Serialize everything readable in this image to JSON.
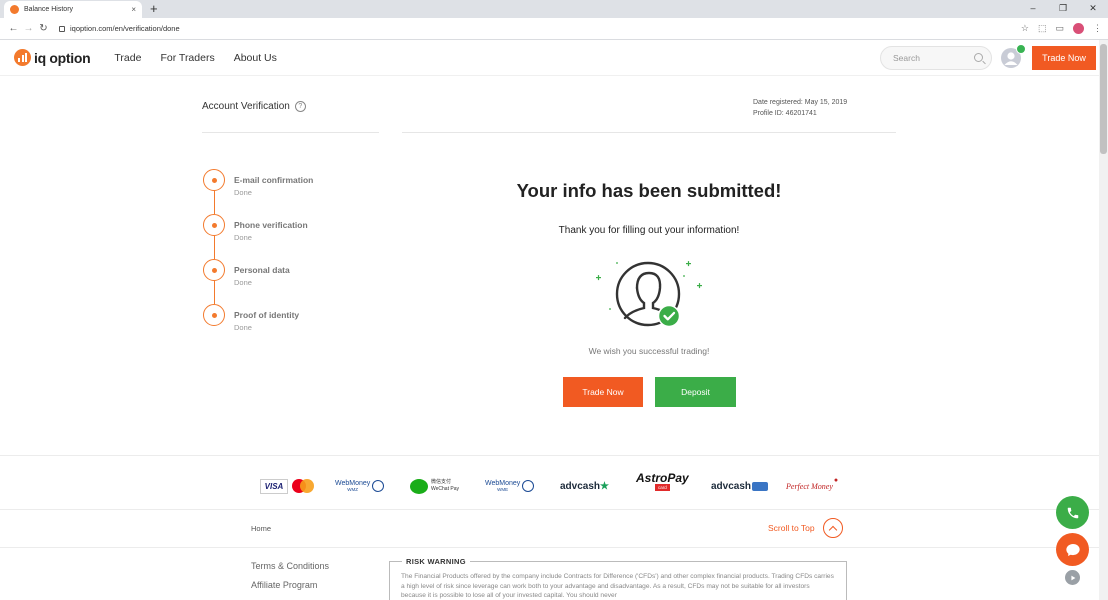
{
  "browser": {
    "tab_title": "Balance History",
    "tab_close": "×",
    "new_tab": "+",
    "url": "iqoption.com/en/verification/done",
    "window_controls": [
      "–",
      "❐",
      "✕"
    ]
  },
  "header": {
    "logo_text": "iq option",
    "nav": [
      "Trade",
      "For Traders",
      "About Us"
    ],
    "search_placeholder": "Search",
    "trade_now": "Trade Now"
  },
  "verification": {
    "title": "Account Verification",
    "help": "?",
    "date_registered": "Date registered: May 15, 2019",
    "profile_id": "Profile ID: 46201741",
    "steps": [
      {
        "title": "E-mail confirmation",
        "status": "Done"
      },
      {
        "title": "Phone verification",
        "status": "Done"
      },
      {
        "title": "Personal data",
        "status": "Done"
      },
      {
        "title": "Proof of identity",
        "status": "Done"
      }
    ],
    "headline": "Your info has been submitted!",
    "thanks": "Thank you for filling out your information!",
    "wish": "We wish you successful trading!",
    "trade_now": "Trade Now",
    "deposit": "Deposit"
  },
  "payments": {
    "visa": "VISA",
    "webmoney": "WebMoney",
    "wmz": "WMZ",
    "wme": "WME",
    "wechat_cn": "微信支付",
    "wechat_en": "WeChat Pay",
    "advcash": "advcash",
    "astropay": "AstroPay",
    "astropay_card": "card",
    "perfect_money": "Perfect Money"
  },
  "footer": {
    "home": "Home",
    "scroll_top": "Scroll to Top",
    "links": [
      "Terms & Conditions",
      "Affiliate Program"
    ],
    "risk_title": "RISK WARNING",
    "risk_text": "The Financial Products offered by the company include Contracts for Difference ('CFDs') and other complex financial products. Trading CFDs carries a high level of risk since leverage can work both to your advantage and disadvantage. As a result, CFDs may not be suitable for all investors because it is possible to lose all of your invested capital. You should never"
  },
  "colors": {
    "accent": "#f15a22",
    "success": "#3bad48"
  }
}
